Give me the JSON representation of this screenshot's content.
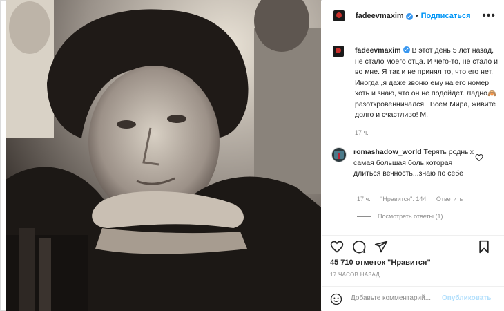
{
  "post": {
    "username": "fadeevmaxim",
    "follow_label": "Подписаться",
    "separator": "•",
    "more_label": "•••",
    "caption_username": "fadeevmaxim",
    "caption_text": " В этот день 5 лет назад, не стало моего отца. И чего-то, не стало и во мне. Я так и не принял то, что его нет. Иногда ,я даже звоню ему на его номер хоть и знаю, что он не подойдёт. Ладно🙈 разоткровенничался.. Всем Мира, живите долго и счастливо! М.",
    "caption_time": "17 ч.",
    "likes": "45 710 отметок \"Нравится\"",
    "posted_ago": "17 ЧАСОВ НАЗАД"
  },
  "comment": {
    "username": "romashadow_world",
    "text": " Терять родных самая большая боль.которая длиться вечность...знаю по себе",
    "time": "17 ч.",
    "likes": "\"Нравится\": 144",
    "reply_label": "Ответить",
    "view_replies": "Посмотреть ответы (1)"
  },
  "add_comment": {
    "placeholder": "Добавьте комментарий...",
    "publish_label": "Опубликовать"
  },
  "icons": {
    "like": "heart-icon",
    "comment": "comment-icon",
    "share": "share-icon",
    "save": "bookmark-icon",
    "emoji": "smiley-icon",
    "verified": "verified-badge-icon",
    "options": "more-options-icon"
  },
  "colors": {
    "link": "#0095f6",
    "verified": "#3897f0",
    "muted": "#8e8e8e",
    "publish_disabled": "#b2dffc"
  }
}
